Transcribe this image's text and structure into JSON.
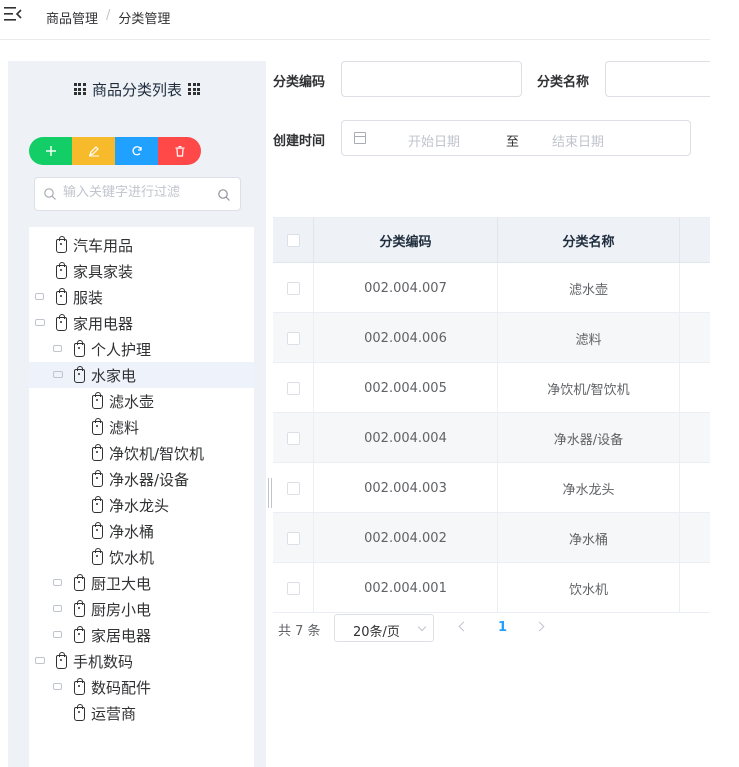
{
  "breadcrumb": [
    "商品管理",
    "分类管理"
  ],
  "breadcrumb_sep": "/",
  "tree_panel": {
    "title": "商品分类列表",
    "filter_placeholder": "输入关键字进行过滤",
    "nodes": [
      {
        "label": "汽车用品",
        "level": 0,
        "expandable": false
      },
      {
        "label": "家具家装",
        "level": 0,
        "expandable": false
      },
      {
        "label": "服装",
        "level": 0,
        "expandable": true,
        "expanded": false
      },
      {
        "label": "家用电器",
        "level": 0,
        "expandable": true,
        "expanded": true
      },
      {
        "label": "个人护理",
        "level": 1,
        "expandable": true,
        "expanded": false
      },
      {
        "label": "水家电",
        "level": 1,
        "expandable": true,
        "expanded": true,
        "current": true
      },
      {
        "label": "滤水壶",
        "level": 2,
        "expandable": false
      },
      {
        "label": "滤料",
        "level": 2,
        "expandable": false
      },
      {
        "label": "净饮机/智饮机",
        "level": 2,
        "expandable": false
      },
      {
        "label": "净水器/设备",
        "level": 2,
        "expandable": false
      },
      {
        "label": "净水龙头",
        "level": 2,
        "expandable": false
      },
      {
        "label": "净水桶",
        "level": 2,
        "expandable": false
      },
      {
        "label": "饮水机",
        "level": 2,
        "expandable": false
      },
      {
        "label": "厨卫大电",
        "level": 1,
        "expandable": true,
        "expanded": false
      },
      {
        "label": "厨房小电",
        "level": 1,
        "expandable": true,
        "expanded": false
      },
      {
        "label": "家居电器",
        "level": 1,
        "expandable": true,
        "expanded": false
      },
      {
        "label": "手机数码",
        "level": 0,
        "expandable": true,
        "expanded": true
      },
      {
        "label": "数码配件",
        "level": 1,
        "expandable": true,
        "expanded": false
      },
      {
        "label": "运营商",
        "level": 1,
        "expandable": false
      }
    ]
  },
  "search_form": {
    "code_label": "分类编码",
    "name_label": "分类名称",
    "time_label": "创建时间",
    "start_placeholder": "开始日期",
    "range_sep": "至",
    "end_placeholder": "结束日期"
  },
  "table": {
    "columns": [
      "分类编码",
      "分类名称"
    ],
    "rows": [
      {
        "code": "002.004.007",
        "name": "滤水壶"
      },
      {
        "code": "002.004.006",
        "name": "滤料"
      },
      {
        "code": "002.004.005",
        "name": "净饮机/智饮机"
      },
      {
        "code": "002.004.004",
        "name": "净水器/设备"
      },
      {
        "code": "002.004.003",
        "name": "净水龙头"
      },
      {
        "code": "002.004.002",
        "name": "净水桶"
      },
      {
        "code": "002.004.001",
        "name": "饮水机"
      }
    ]
  },
  "pagination": {
    "total_text": "共 7 条",
    "page_size": "20条/页",
    "current_page": "1"
  },
  "colors": {
    "add": "#13ce66",
    "edit": "#f7ba2a",
    "refresh": "#20a0ff",
    "delete": "#ff4949",
    "panel_bg": "#eef1f6",
    "active_page": "#20a0ff"
  },
  "icons": {
    "add": "plus-icon",
    "edit": "pencil-icon",
    "refresh": "refresh-icon",
    "delete": "trash-icon",
    "node": "tag-icon"
  }
}
